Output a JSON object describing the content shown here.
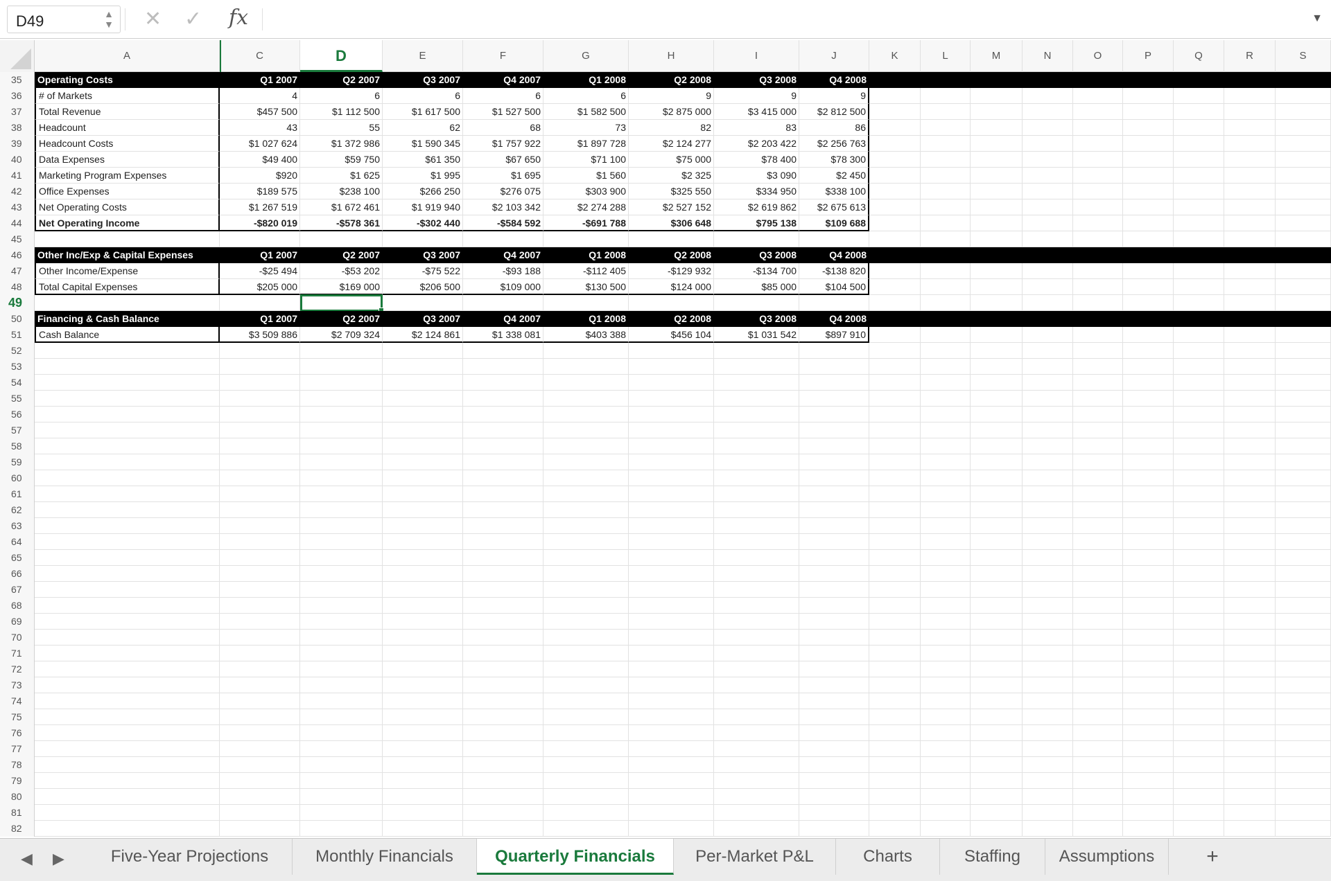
{
  "formula_bar": {
    "cell_ref": "D49",
    "fx_label": "fx",
    "formula": ""
  },
  "columns": [
    "A",
    "C",
    "D",
    "E",
    "F",
    "G",
    "H",
    "I",
    "J",
    "K",
    "L",
    "M",
    "N",
    "O",
    "P",
    "Q",
    "R",
    "S"
  ],
  "active_column": "D",
  "active_row": "49",
  "rows": [
    {
      "r": "35",
      "type": "hdr",
      "label": "Operating Costs",
      "vals": [
        "Q1 2007",
        "Q2 2007",
        "Q3 2007",
        "Q4 2007",
        "Q1 2008",
        "Q2 2008",
        "Q3 2008",
        "Q4 2008"
      ]
    },
    {
      "r": "36",
      "type": "data",
      "label": "# of Markets",
      "vals": [
        "4",
        "6",
        "6",
        "6",
        "6",
        "9",
        "9",
        "9"
      ]
    },
    {
      "r": "37",
      "type": "data",
      "label": "Total Revenue",
      "vals": [
        "$457 500",
        "$1 112 500",
        "$1 617 500",
        "$1 527 500",
        "$1 582 500",
        "$2 875 000",
        "$3 415 000",
        "$2 812 500"
      ]
    },
    {
      "r": "38",
      "type": "data",
      "label": "Headcount",
      "vals": [
        "43",
        "55",
        "62",
        "68",
        "73",
        "82",
        "83",
        "86"
      ]
    },
    {
      "r": "39",
      "type": "data",
      "label": "Headcount Costs",
      "vals": [
        "$1 027 624",
        "$1 372 986",
        "$1 590 345",
        "$1 757 922",
        "$1 897 728",
        "$2 124 277",
        "$2 203 422",
        "$2 256 763"
      ]
    },
    {
      "r": "40",
      "type": "data",
      "label": "Data Expenses",
      "vals": [
        "$49 400",
        "$59 750",
        "$61 350",
        "$67 650",
        "$71 100",
        "$75 000",
        "$78 400",
        "$78 300"
      ]
    },
    {
      "r": "41",
      "type": "data",
      "label": "Marketing Program Expenses",
      "vals": [
        "$920",
        "$1 625",
        "$1 995",
        "$1 695",
        "$1 560",
        "$2 325",
        "$3 090",
        "$2 450"
      ]
    },
    {
      "r": "42",
      "type": "data",
      "label": "Office Expenses",
      "vals": [
        "$189 575",
        "$238 100",
        "$266 250",
        "$276 075",
        "$303 900",
        "$325 550",
        "$334 950",
        "$338 100"
      ]
    },
    {
      "r": "43",
      "type": "data",
      "label": "Net Operating Costs",
      "vals": [
        "$1 267 519",
        "$1 672 461",
        "$1 919 940",
        "$2 103 342",
        "$2 274 288",
        "$2 527 152",
        "$2 619 862",
        "$2 675 613"
      ]
    },
    {
      "r": "44",
      "type": "total",
      "label": "Net Operating Income",
      "vals": [
        "-$820 019",
        "-$578 361",
        "-$302 440",
        "-$584 592",
        "-$691 788",
        "$306 648",
        "$795 138",
        "$109 688"
      ]
    },
    {
      "r": "45",
      "type": "empty",
      "label": "",
      "vals": []
    },
    {
      "r": "46",
      "type": "hdr",
      "label": "Other Inc/Exp & Capital Expenses",
      "vals": [
        "Q1 2007",
        "Q2 2007",
        "Q3 2007",
        "Q4 2007",
        "Q1 2008",
        "Q2 2008",
        "Q3 2008",
        "Q4 2008"
      ]
    },
    {
      "r": "47",
      "type": "data",
      "label": "Other Income/Expense",
      "vals": [
        "-$25 494",
        "-$53 202",
        "-$75 522",
        "-$93 188",
        "-$112 405",
        "-$129 932",
        "-$134 700",
        "-$138 820"
      ]
    },
    {
      "r": "48",
      "type": "data-last",
      "label": "Total Capital Expenses",
      "vals": [
        "$205 000",
        "$169 000",
        "$206 500",
        "$109 000",
        "$130 500",
        "$124 000",
        "$85 000",
        "$104 500"
      ]
    },
    {
      "r": "49",
      "type": "empty",
      "label": "",
      "vals": []
    },
    {
      "r": "50",
      "type": "hdr",
      "label": "Financing & Cash Balance",
      "vals": [
        "Q1 2007",
        "Q2 2007",
        "Q3 2007",
        "Q4 2007",
        "Q1 2008",
        "Q2 2008",
        "Q3 2008",
        "Q4 2008"
      ]
    },
    {
      "r": "51",
      "type": "data-last",
      "label": "Cash Balance",
      "vals": [
        "$3 509 886",
        "$2 709 324",
        "$2 124 861",
        "$1 338 081",
        "$403 388",
        "$456 104",
        "$1 031 542",
        "$897 910"
      ]
    }
  ],
  "empty_rows": [
    "52",
    "53",
    "54",
    "55",
    "56",
    "57",
    "58",
    "59",
    "60",
    "61",
    "62",
    "63",
    "64",
    "65",
    "66",
    "67",
    "68",
    "69",
    "70",
    "71",
    "72",
    "73",
    "74",
    "75",
    "76",
    "77",
    "78",
    "79",
    "80",
    "81",
    "82"
  ],
  "tabs": [
    {
      "label": "Five-Year Projections",
      "active": false
    },
    {
      "label": "Monthly Financials",
      "active": false
    },
    {
      "label": "Quarterly Financials",
      "active": true
    },
    {
      "label": "Per-Market P&L",
      "active": false
    },
    {
      "label": "Charts",
      "active": false
    },
    {
      "label": "Staffing",
      "active": false
    },
    {
      "label": "Assumptions",
      "active": false
    }
  ],
  "tab_add_label": "+",
  "colors": {
    "accent": "#1a7a3c",
    "header_bg": "#000000"
  }
}
